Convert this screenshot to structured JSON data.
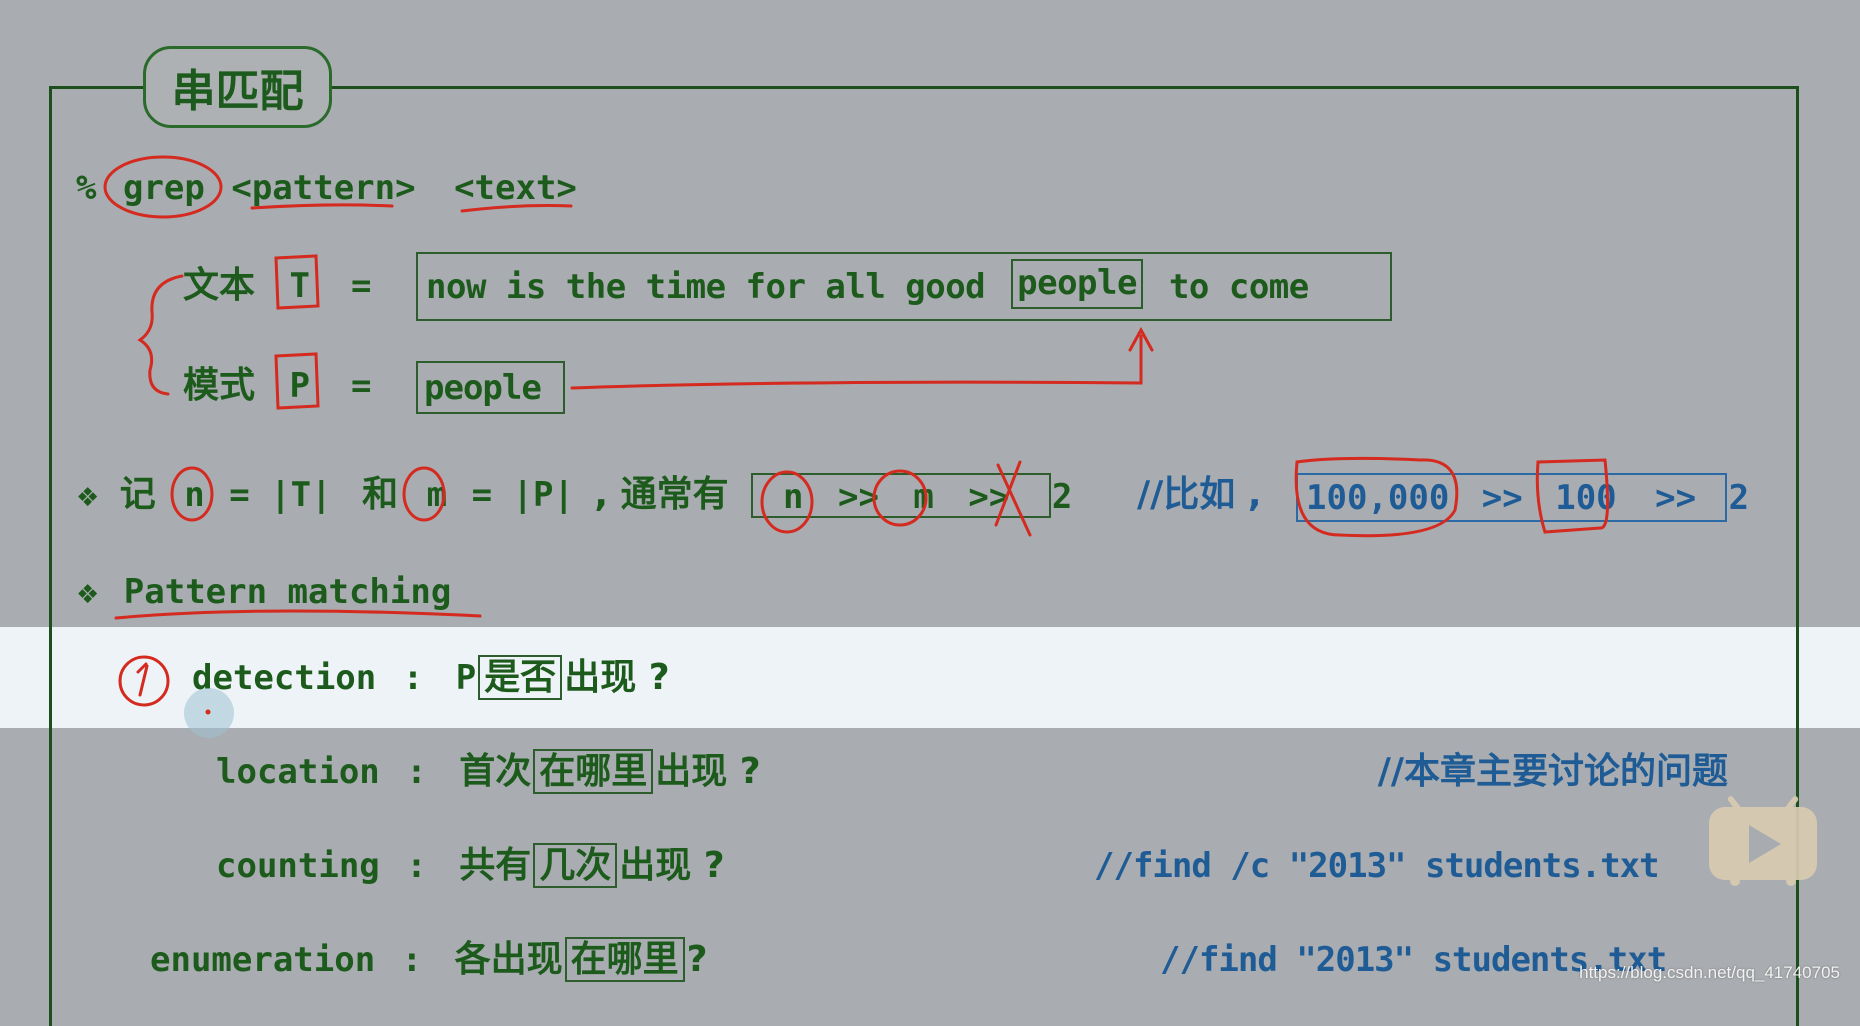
{
  "slide": {
    "title": "串匹配",
    "command": {
      "prompt": "%",
      "cmd": "grep",
      "arg1": "<pattern>",
      "arg2": "<text>"
    },
    "text_row": {
      "label": "文本",
      "var": "T",
      "eq": "=",
      "words_before": "now is the time for all good",
      "match": "people",
      "words_after": "to come"
    },
    "pattern_row": {
      "label": "模式",
      "var": "P",
      "eq": "=",
      "value": "people"
    },
    "notation": {
      "bullet": "❖",
      "prefix": "记",
      "n": "n",
      "eq_t": "= |T|",
      "and": "和",
      "m": "m",
      "eq_p": "= |P|",
      "usually": ", 通常有",
      "box": {
        "n": "n",
        "gg1": ">>",
        "m": "m",
        "gg2": ">>",
        "two": "2"
      },
      "example_prefix": "//比如 ,",
      "example": {
        "big": "100,000",
        "gg1": ">>",
        "mid": "100",
        "gg2": ">>",
        "small": "2"
      }
    },
    "pattern_matching": {
      "bullet": "❖",
      "heading": "Pattern matching",
      "items": [
        {
          "term": "detection",
          "colon": ":",
          "pre": "P",
          "boxed": "是否",
          "post": "出现 ?",
          "comment": "",
          "annotation": "1"
        },
        {
          "term": "location",
          "colon": ":",
          "pre": "首次",
          "boxed": "在哪里",
          "post": "出现 ?",
          "comment": "//本章主要讨论的问题"
        },
        {
          "term": "counting",
          "colon": ":",
          "pre": "共有",
          "boxed": "几次",
          "post": "出现 ?",
          "comment": "//find /c \"2013\" students.txt"
        },
        {
          "term": "enumeration",
          "colon": ":",
          "pre": "各出现",
          "boxed": "在哪里",
          "post": "?",
          "comment": "//find \"2013\" students.txt"
        }
      ]
    }
  },
  "overlay": {
    "player_icon": "tv-play-icon",
    "watermark": "https://blog.csdn.net/qq_41740705"
  },
  "colors": {
    "ink_green": "#1d5b1d",
    "comment_blue": "#1f5c96",
    "annotation_red": "#d42a1f",
    "background": "#a9acb0",
    "highlight": "#eef3f7"
  }
}
